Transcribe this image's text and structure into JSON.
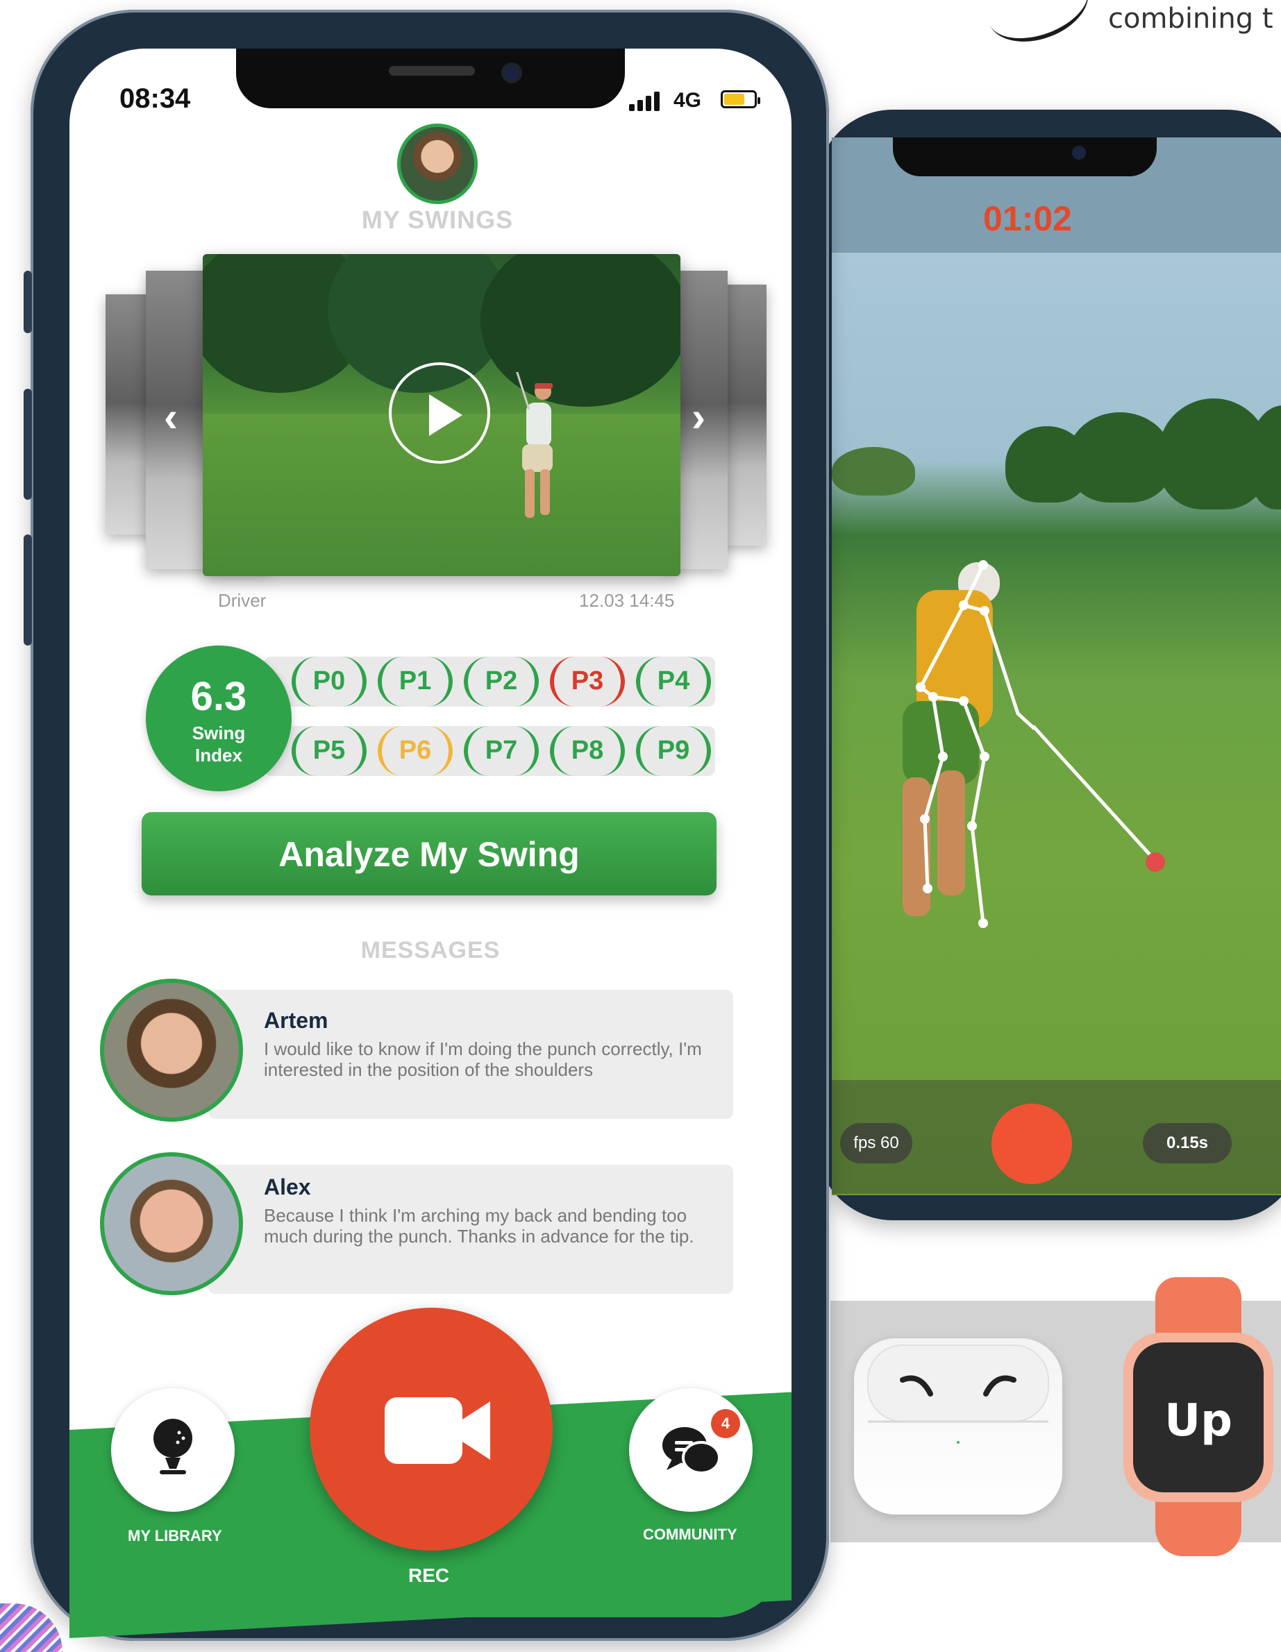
{
  "brand": {
    "tagline": "combining t"
  },
  "phone_main": {
    "status": {
      "time": "08:34",
      "network": "4G"
    },
    "swings": {
      "title": "MY SWINGS",
      "club": "Driver",
      "date": "12.03 14:45"
    },
    "swing_index": {
      "value": "6.3",
      "label": "Swing Index"
    },
    "positions_row1": [
      {
        "label": "P0",
        "state": "good"
      },
      {
        "label": "P1",
        "state": "good"
      },
      {
        "label": "P2",
        "state": "good"
      },
      {
        "label": "P3",
        "state": "bad"
      },
      {
        "label": "P4",
        "state": "good"
      }
    ],
    "positions_row2": [
      {
        "label": "P5",
        "state": "good"
      },
      {
        "label": "P6",
        "state": "warning"
      },
      {
        "label": "P7",
        "state": "good"
      },
      {
        "label": "P8",
        "state": "good"
      },
      {
        "label": "P9",
        "state": "good"
      }
    ],
    "analyze_button": "Analyze My Swing",
    "messages": {
      "title": "MESSAGES",
      "items": [
        {
          "name": "Artem",
          "text": "I would like to know if I'm doing the punch correctly, I'm interested in the position of the shoulders"
        },
        {
          "name": "Alex",
          "text": "Because I think I'm arching my back and bending too much during the punch. Thanks in advance for the tip."
        }
      ]
    },
    "nav": {
      "library": "MY LIBRARY",
      "rec": "REC",
      "community": "COMMUNITY",
      "community_badge": "4"
    }
  },
  "phone_camera": {
    "timer": "01:02",
    "fps": "fps 60",
    "speed": "0.15s"
  },
  "watch": {
    "logo": "Up"
  },
  "colors": {
    "accent_green": "#2ea34a",
    "accent_red": "#e34a2c",
    "warning": "#f2b53b"
  }
}
